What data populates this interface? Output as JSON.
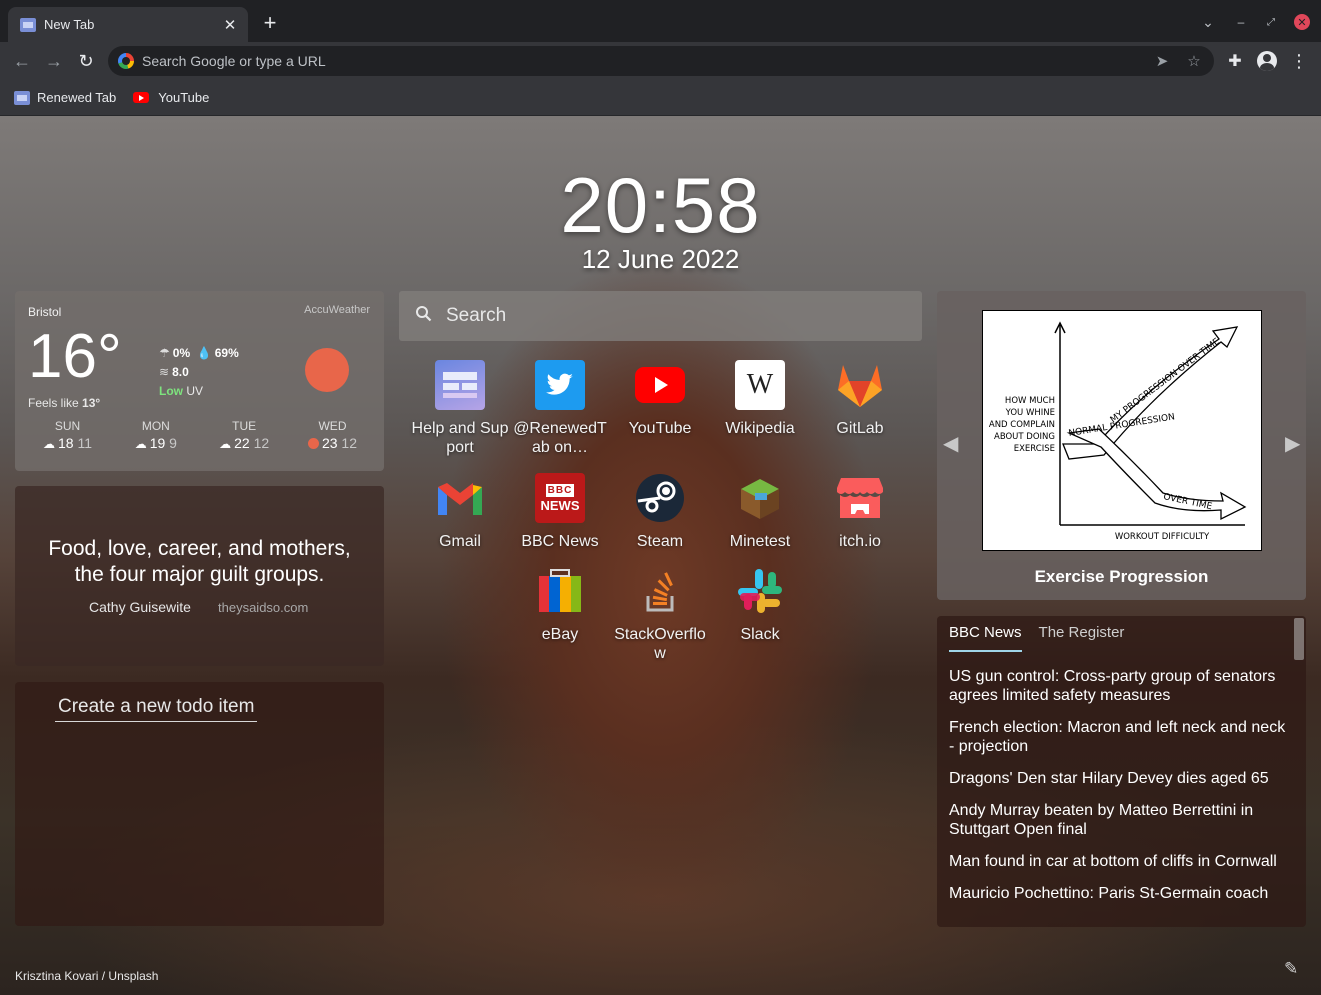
{
  "browser": {
    "tab_title": "New Tab",
    "omnibox_placeholder": "Search Google or type a URL",
    "bookmarks": [
      {
        "label": "Renewed Tab",
        "icon": "renewed-tab-icon"
      },
      {
        "label": "YouTube",
        "icon": "youtube-icon"
      }
    ]
  },
  "clock": {
    "time": "20:58",
    "date": "12 June 2022"
  },
  "weather": {
    "city": "Bristol",
    "provider": "AccuWeather",
    "temp": "16°",
    "feels_like_label": "Feels like",
    "feels_like_value": "13°",
    "precip": "0%",
    "humidity": "69%",
    "wind": "8.0",
    "uv_level": "Low",
    "uv_label": "UV",
    "sun_color": "#e8664a",
    "forecast": [
      {
        "day": "SUN",
        "high": "18",
        "low": "11",
        "icon": "partly-cloudy-icon"
      },
      {
        "day": "MON",
        "high": "19",
        "low": "9",
        "icon": "cloud-icon"
      },
      {
        "day": "TUE",
        "high": "22",
        "low": "12",
        "icon": "partly-cloudy-icon"
      },
      {
        "day": "WED",
        "high": "23",
        "low": "12",
        "icon": "sun-icon"
      }
    ]
  },
  "quote": {
    "text": "Food, love, career, and mothers, the four major guilt groups.",
    "author": "Cathy Guisewite",
    "source": "theysaidso.com"
  },
  "todo": {
    "placeholder": "Create a new todo item"
  },
  "search": {
    "placeholder": "Search"
  },
  "shortcuts": [
    {
      "label": "Help and Support",
      "icon": "help-support-icon"
    },
    {
      "label": "@RenewedTab on…",
      "icon": "twitter-icon"
    },
    {
      "label": "YouTube",
      "icon": "youtube-icon"
    },
    {
      "label": "Wikipedia",
      "icon": "wikipedia-icon"
    },
    {
      "label": "GitLab",
      "icon": "gitlab-icon"
    },
    {
      "label": "Gmail",
      "icon": "gmail-icon"
    },
    {
      "label": "BBC News",
      "icon": "bbc-news-icon"
    },
    {
      "label": "Steam",
      "icon": "steam-icon"
    },
    {
      "label": "Minetest",
      "icon": "minetest-icon"
    },
    {
      "label": "itch.io",
      "icon": "itchio-icon"
    },
    {
      "label": "eBay",
      "icon": "ebay-icon"
    },
    {
      "label": "StackOverflow",
      "icon": "stackoverflow-icon"
    },
    {
      "label": "Slack",
      "icon": "slack-icon"
    }
  ],
  "xkcd": {
    "title": "Exercise Progression",
    "comic": {
      "ylabel": [
        "HOW MUCH",
        "YOU WHINE",
        "AND COMPLAIN",
        "ABOUT DOING",
        "EXERCISE"
      ],
      "xlabel": "WORKOUT DIFFICULTY",
      "line_up": "MY PROGRESSION OVER TIME",
      "line_normal_1": "NORMAL PROGRESSION",
      "line_normal_2": "OVER TIME"
    }
  },
  "feed": {
    "tabs": [
      "BBC News",
      "The Register"
    ],
    "items": [
      "US gun control: Cross-party group of senators agrees limited safety measures",
      "French election: Macron and left neck and neck - projection",
      "Dragons' Den star Hilary Devey dies aged 65",
      "Andy Murray beaten by Matteo Berrettini in Stuttgart Open final",
      "Man found in car at bottom of cliffs in Cornwall",
      "Mauricio Pochettino: Paris St-Germain coach"
    ]
  },
  "photo_credit": {
    "author": "Krisztina Kovari",
    "separator": "/",
    "site": "Unsplash"
  }
}
